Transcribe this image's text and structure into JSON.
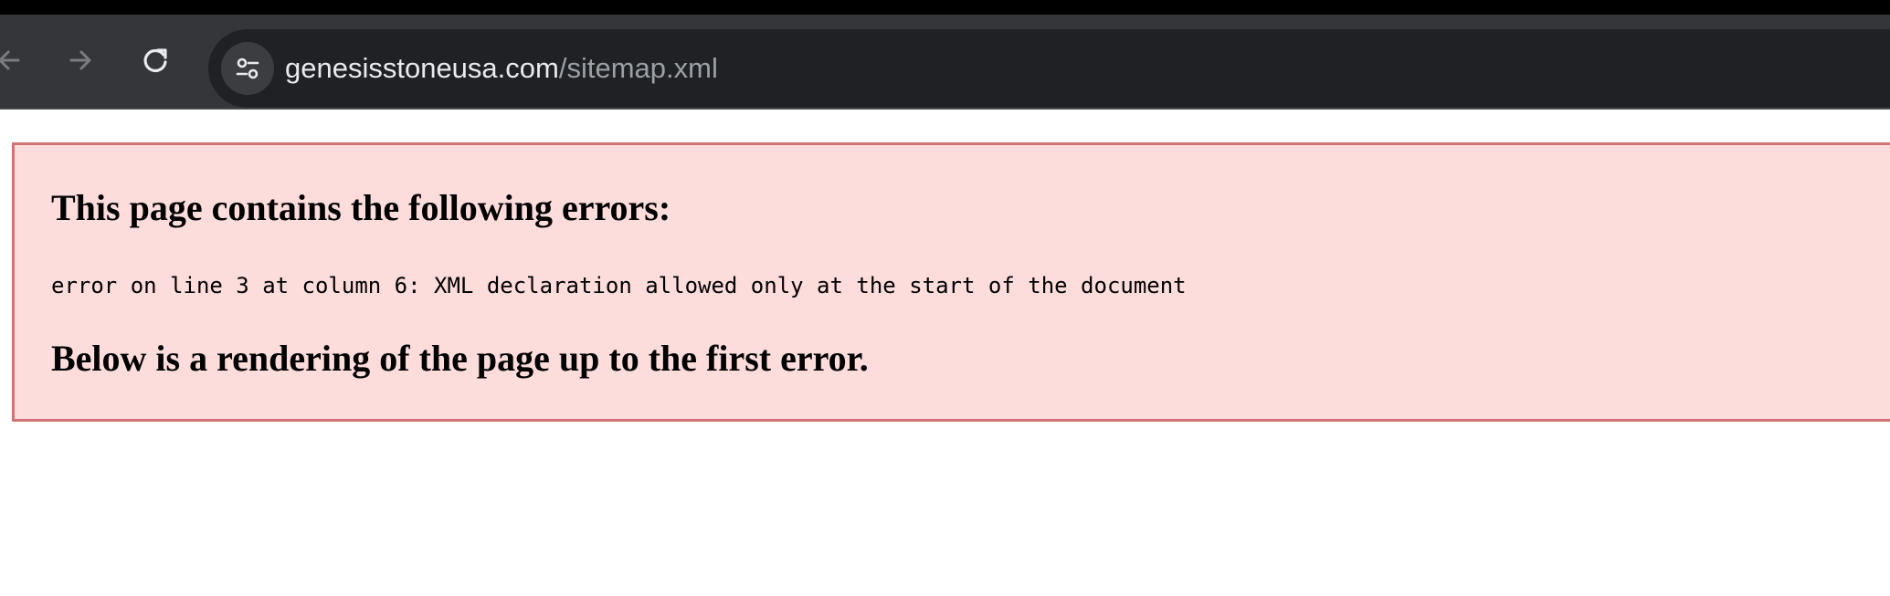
{
  "browser": {
    "back_icon": "arrow-left-icon",
    "forward_icon": "arrow-right-icon",
    "reload_icon": "reload-icon",
    "site_info_icon": "tune-icon",
    "url_host": "genesisstoneusa.com",
    "url_path": "/sitemap.xml",
    "colors": {
      "toolbar": "#35363a",
      "omnibox": "#202124",
      "url_host": "#e8eaed",
      "url_path": "#9aa0a6"
    }
  },
  "error_page": {
    "title": "This page contains the following errors:",
    "message": "error on line 3 at column 6: XML declaration allowed only at the start of the document",
    "footer": "Below is a rendering of the page up to the first error.",
    "colors": {
      "background": "#fddcdc",
      "border": "#d27374"
    }
  }
}
